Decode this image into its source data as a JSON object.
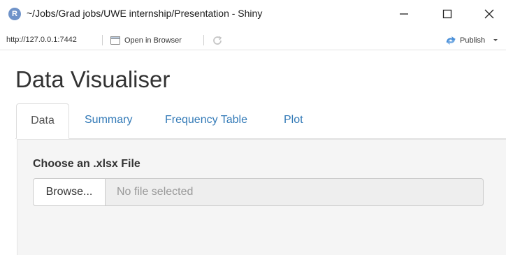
{
  "window": {
    "title": "~/Jobs/Grad jobs/UWE internship/Presentation - Shiny",
    "logo_letter": "R"
  },
  "toolbar": {
    "url": "http://127.0.0.1:7442",
    "open_in_browser": "Open in Browser",
    "publish": "Publish"
  },
  "app": {
    "title": "Data Visualiser",
    "tabs": [
      {
        "label": "Data",
        "active": true
      },
      {
        "label": "Summary",
        "active": false
      },
      {
        "label": "Frequency Table",
        "active": false
      },
      {
        "label": "Plot",
        "active": false
      }
    ],
    "file_input": {
      "label": "Choose an .xlsx File",
      "browse_label": "Browse...",
      "placeholder": "No file selected"
    }
  },
  "colors": {
    "link": "#337ab7",
    "panel_bg": "#f5f5f5",
    "r_logo": "#6f93c9",
    "publish_icon": "#4a90d9"
  },
  "icons": {
    "logo": "r-logo-icon",
    "minimize": "minimize-icon",
    "maximize": "maximize-icon",
    "close": "close-icon",
    "open_in_browser": "browser-window-icon",
    "refresh": "refresh-icon",
    "publish": "publish-icon",
    "publish_menu": "chevron-down-icon"
  }
}
